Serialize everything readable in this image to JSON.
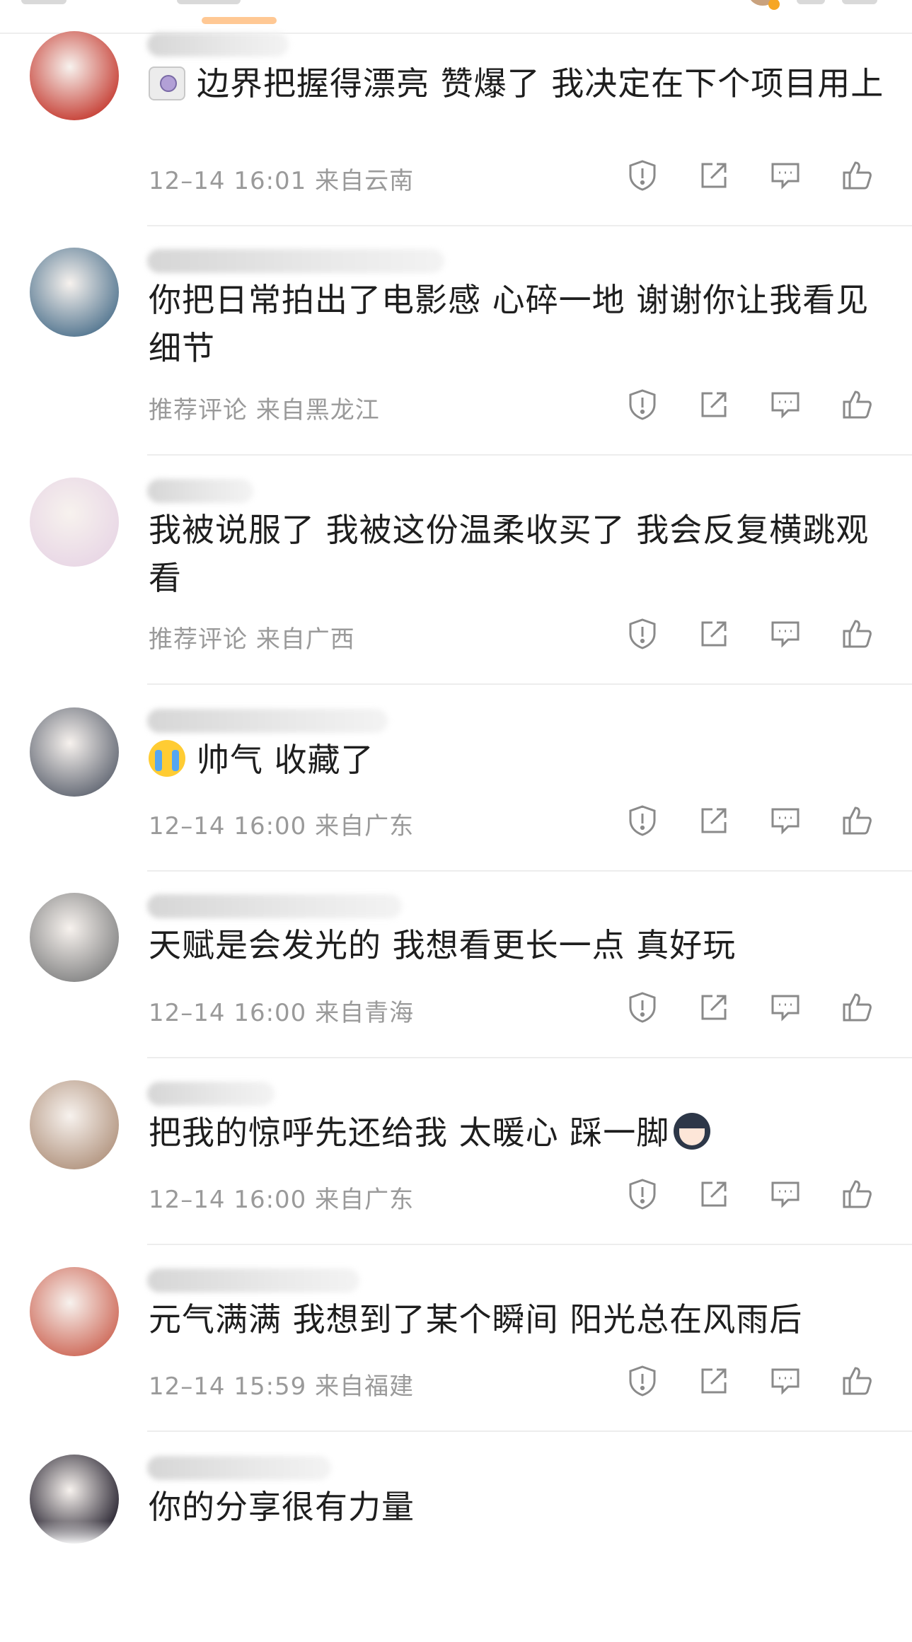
{
  "comments": [
    {
      "text": "边界把握得漂亮 赞爆了 我决定在下个项目用上",
      "emoji_prefix": "camera-emoji",
      "time": "12–14 16:01",
      "location": "来自云南",
      "avatar_color": "#c8463c"
    },
    {
      "text": "你把日常拍出了电影感 心碎一地 谢谢你让我看见细节",
      "time": "推荐评论",
      "location": "来自黑龙江",
      "avatar_color": "#5a7b94"
    },
    {
      "text": "我被说服了 我被这份温柔收买了 我会反复横跳观看",
      "time": "推荐评论",
      "location": "来自广西",
      "avatar_color": "#e9d8e6"
    },
    {
      "text": "帅气 收藏了",
      "emoji_prefix": "crying-emoji",
      "time": "12–14 16:00",
      "location": "来自广东",
      "avatar_color": "#6a6f7a"
    },
    {
      "text": "天赋是会发光的 我想看更长一点 真好玩",
      "time": "12–14 16:00",
      "location": "来自青海",
      "avatar_color": "#8a8a8a"
    },
    {
      "text": "把我的惊呼先还给我 太暖心 踩一脚",
      "emoji_suffix": "boy-face-emoji",
      "time": "12–14 16:00",
      "location": "来自广东",
      "avatar_color": "#b69a86"
    },
    {
      "text": "元气满满 我想到了某个瞬间 阳光总在风雨后",
      "time": "12–14 15:59",
      "location": "来自福建",
      "avatar_color": "#d07060"
    },
    {
      "text": "你的分享很有力量",
      "time": "",
      "location": "",
      "avatar_color": "#2e2a36"
    }
  ],
  "icons": [
    "report-icon",
    "share-icon",
    "comment-icon",
    "like-icon"
  ],
  "colors": {
    "text": "#1e1e1e",
    "meta": "#9a9a9a",
    "icon": "#888888",
    "divider": "#ededed"
  }
}
